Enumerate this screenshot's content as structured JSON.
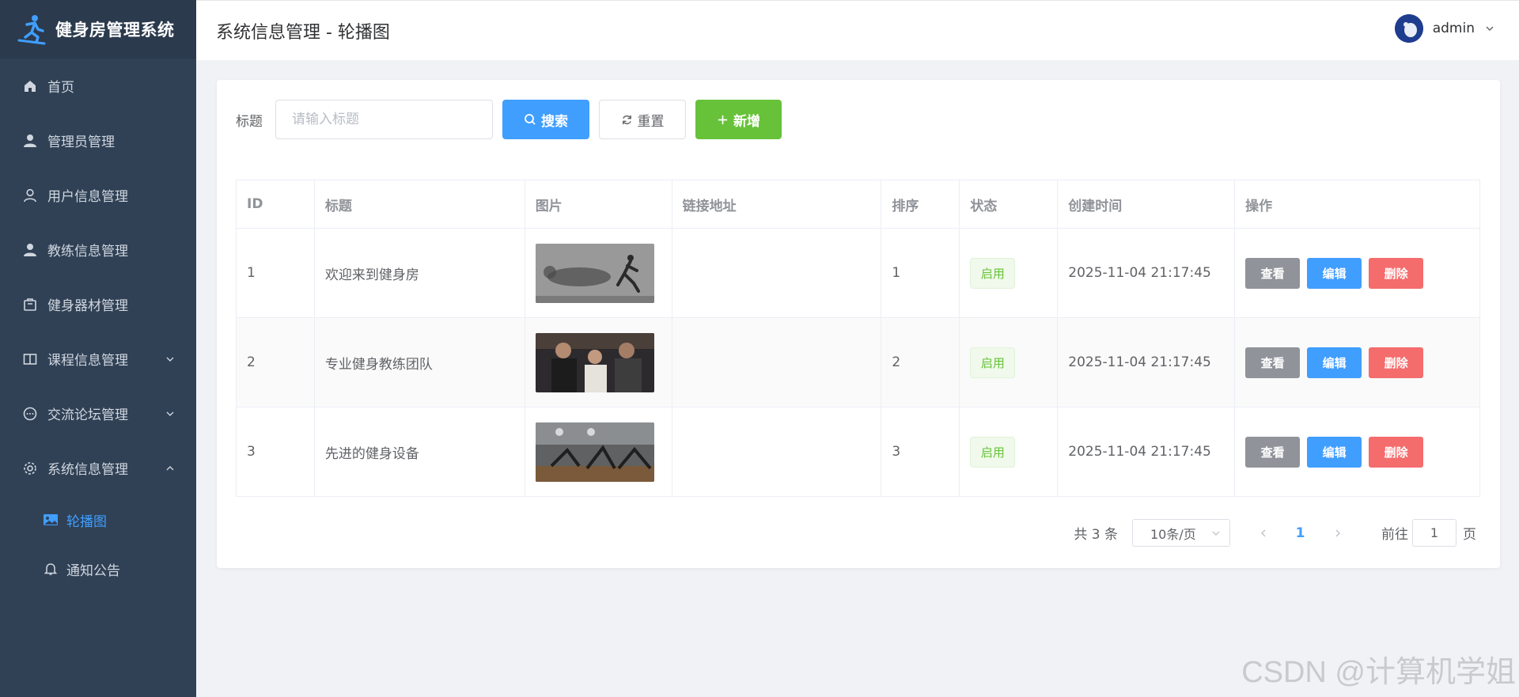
{
  "app": {
    "title": "健身房管理系统"
  },
  "sidebar": {
    "items": [
      {
        "label": "首页",
        "icon": "home-icon"
      },
      {
        "label": "管理员管理",
        "icon": "user-icon"
      },
      {
        "label": "用户信息管理",
        "icon": "user-outline-icon"
      },
      {
        "label": "教练信息管理",
        "icon": "user-icon"
      },
      {
        "label": "健身器材管理",
        "icon": "box-icon"
      },
      {
        "label": "课程信息管理",
        "icon": "book-icon",
        "expandable": true
      },
      {
        "label": "交流论坛管理",
        "icon": "chat-icon",
        "expandable": true
      },
      {
        "label": "系统信息管理",
        "icon": "gear-icon",
        "expanded": true
      }
    ],
    "subitems": [
      {
        "label": "轮播图",
        "icon": "image-icon",
        "active": true
      },
      {
        "label": "通知公告",
        "icon": "bell-icon"
      }
    ]
  },
  "header": {
    "title": "系统信息管理 - 轮播图",
    "username": "admin"
  },
  "search": {
    "label": "标题",
    "placeholder": "请输入标题",
    "value": "",
    "search_label": "搜索",
    "reset_label": "重置",
    "add_label": "新增"
  },
  "table": {
    "columns": [
      "ID",
      "标题",
      "图片",
      "链接地址",
      "排序",
      "状态",
      "创建时间",
      "操作"
    ],
    "rows": [
      {
        "id": "1",
        "title": "欢迎来到健身房",
        "link": "",
        "sort": "1",
        "status": "启用",
        "created": "2025-11-04 21:17:45",
        "image": "runner-with-cheetah-shadow"
      },
      {
        "id": "2",
        "title": "专业健身教练团队",
        "link": "",
        "sort": "2",
        "status": "启用",
        "created": "2025-11-04 21:17:45",
        "image": "trainers-group-photo"
      },
      {
        "id": "3",
        "title": "先进的健身设备",
        "link": "",
        "sort": "3",
        "status": "启用",
        "created": "2025-11-04 21:17:45",
        "image": "gym-equipment-room"
      }
    ],
    "actions": {
      "view": "查看",
      "edit": "编辑",
      "delete": "删除"
    }
  },
  "pagination": {
    "total": "共 3 条",
    "page_size": "10条/页",
    "current_page": "1",
    "goto_prefix": "前往",
    "goto_value": "1",
    "goto_suffix": "页"
  },
  "watermark": "CSDN @计算机学姐",
  "colors": {
    "primary": "#409eff",
    "success": "#67c23a",
    "danger": "#f56c6c",
    "info": "#909399",
    "sidebar": "#304156"
  }
}
